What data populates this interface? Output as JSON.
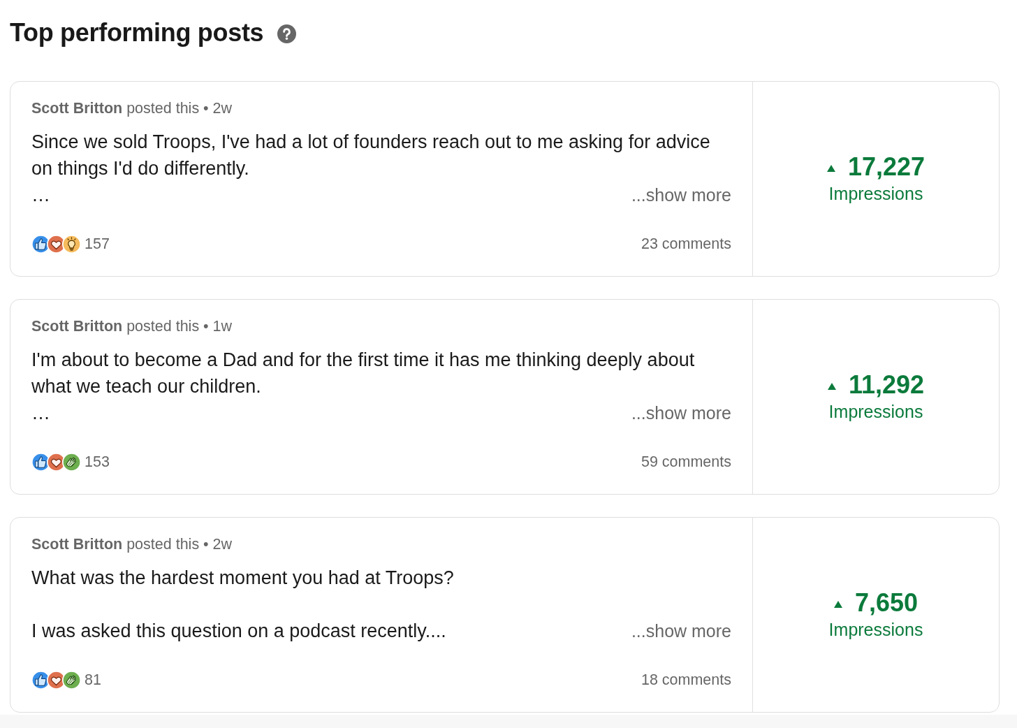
{
  "title": "Top performing posts",
  "posts": [
    {
      "meta": "**Scott Britton** posted this • 2w",
      "paragraphs": [
        "Since we sold Troops, I've had a lot of founders reach out to me asking for advice on things I'd do differently."
      ],
      "ellipsis": "…",
      "show_more": "...show more",
      "reactions": [
        {
          "kind": "like"
        },
        {
          "kind": "love"
        },
        {
          "kind": "insightful"
        }
      ],
      "reaction_count": "157",
      "comments": "23 comments",
      "increase": true,
      "impressions": "17,227",
      "impressions_label": "Impressions"
    },
    {
      "meta": "**Scott Britton** posted this • 1w",
      "paragraphs": [
        "I'm about to become a Dad and for the first time it has me thinking deeply about what we teach our children."
      ],
      "ellipsis": "…",
      "show_more": "...show more",
      "reactions": [
        {
          "kind": "like"
        },
        {
          "kind": "love"
        },
        {
          "kind": "celebrate"
        }
      ],
      "reaction_count": "153",
      "comments": "59 comments",
      "increase": true,
      "impressions": "11,292",
      "impressions_label": "Impressions"
    },
    {
      "meta": "**Scott Britton** posted this • 2w",
      "paragraphs": [
        "What was the hardest moment you had at Troops?",
        "I was asked this question on a podcast recently...."
      ],
      "show_more": "...show more",
      "reactions": [
        {
          "kind": "like"
        },
        {
          "kind": "love"
        },
        {
          "kind": "celebrate"
        }
      ],
      "reaction_count": "81",
      "comments": "18 comments",
      "increase": true,
      "impressions": "7,650",
      "impressions_label": "Impressions"
    }
  ]
}
